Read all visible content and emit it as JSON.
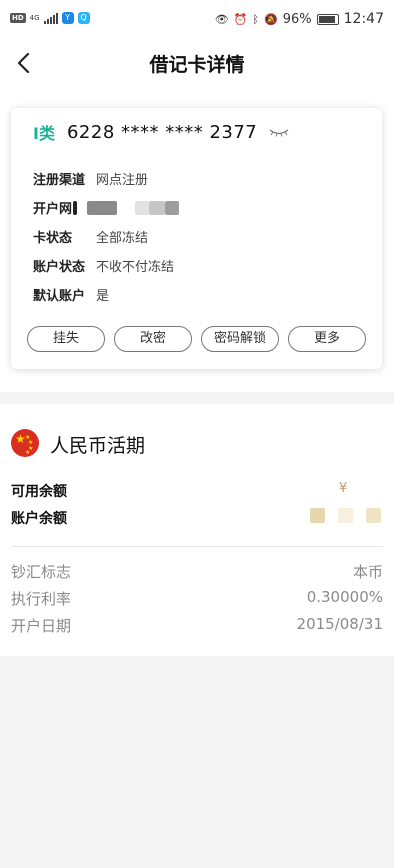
{
  "status_bar": {
    "hd": "HD",
    "net": "4G",
    "app_icon_1": "Y",
    "app_icon_2": "Q",
    "battery": "96%",
    "time": "12:47"
  },
  "header": {
    "title": "借记卡详情"
  },
  "card": {
    "type_badge": "I类",
    "number": "6228 **** **** 2377",
    "rows": [
      {
        "label": "注册渠道",
        "value": "网点注册"
      },
      {
        "label": "开户网",
        "value": ""
      },
      {
        "label": "卡状态",
        "value": "全部冻结"
      },
      {
        "label": "账户状态",
        "value": "不收不付冻结"
      },
      {
        "label": "默认账户",
        "value": "是"
      }
    ],
    "buttons": [
      "挂失",
      "改密",
      "密码解锁",
      "更多"
    ]
  },
  "account": {
    "title": "人民币活期",
    "available_label": "可用余额",
    "available_value": "¥",
    "balance_label": "账户余额",
    "info": [
      {
        "label": "钞汇标志",
        "value": "本币"
      },
      {
        "label": "执行利率",
        "value": "0.30000%"
      },
      {
        "label": "开户日期",
        "value": "2015/08/31"
      }
    ]
  },
  "colors": {
    "accent": "#19b39a",
    "flag_red": "#d92e21",
    "flag_yellow": "#ffd200",
    "page_bg": "#f4f4f4"
  }
}
